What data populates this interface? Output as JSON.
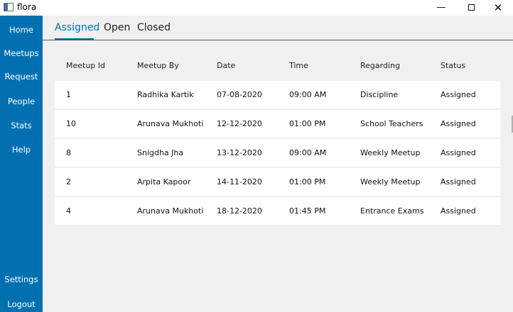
{
  "window": {
    "title": "flora",
    "minimize": "—",
    "close": "✕"
  },
  "sidebar": {
    "items": [
      "Home",
      "Meetups",
      "Request",
      "People",
      "Stats",
      "Help"
    ],
    "bottom_items": [
      "Settings",
      "Logout"
    ]
  },
  "tabs": [
    "Assigned",
    "Open",
    "Closed"
  ],
  "active_tab": "Assigned",
  "colors": {
    "accent": "#0070b1",
    "background": "#f0f0f0",
    "row_background": "#ffffff"
  },
  "table": {
    "columns": [
      "Meetup Id",
      "Meetup By",
      "Date",
      "Time",
      "Regarding",
      "Status"
    ],
    "rows": [
      [
        "1",
        "Radhika Kartik",
        "07-08-2020",
        "09:00 AM",
        "Discipline",
        "Assigned"
      ],
      [
        "10",
        "Arunava Mukhoti",
        "12-12-2020",
        "01:00 PM",
        "School Teachers",
        "Assigned"
      ],
      [
        "8",
        "Snigdha Jha",
        "13-12-2020",
        "09:00 AM",
        "Weekly Meetup",
        "Assigned"
      ],
      [
        "2",
        "Arpita Kapoor",
        "14-11-2020",
        "01:00 PM",
        "Weekly Meetup",
        "Assigned"
      ],
      [
        "4",
        "Arunava Mukhoti",
        "18-12-2020",
        "01:45 PM",
        "Entrance Exams",
        "Assigned"
      ]
    ]
  }
}
